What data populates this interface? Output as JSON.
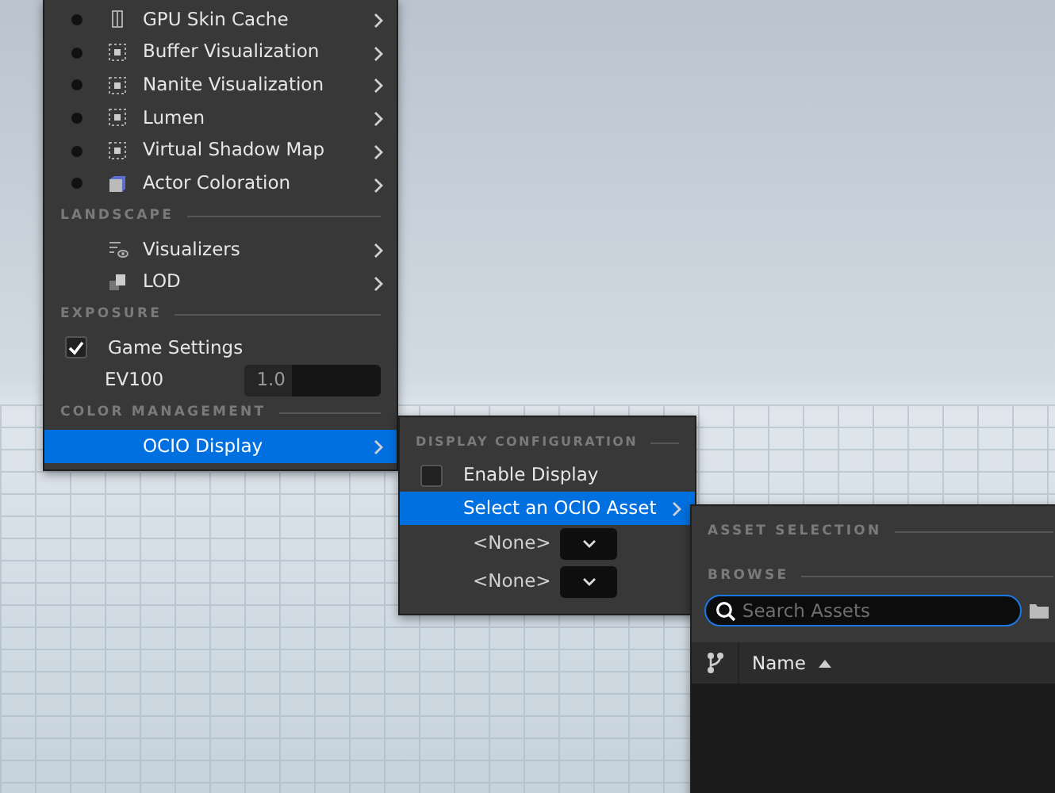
{
  "main_menu": {
    "items": [
      {
        "kind": "skin",
        "label": "GPU Skin Cache",
        "selected": false,
        "submenu": true
      },
      {
        "kind": "grid",
        "label": "Buffer Visualization",
        "selected": false,
        "submenu": true
      },
      {
        "kind": "grid",
        "label": "Nanite Visualization",
        "selected": false,
        "submenu": true
      },
      {
        "kind": "grid",
        "label": "Lumen",
        "selected": false,
        "submenu": true
      },
      {
        "kind": "grid",
        "label": "Virtual Shadow Map",
        "selected": false,
        "submenu": true
      },
      {
        "kind": "cube",
        "label": "Actor Coloration",
        "selected": false,
        "submenu": true
      },
      {
        "kind": "header",
        "label": "LANDSCAPE"
      },
      {
        "kind": "visualizers",
        "label": "Visualizers",
        "submenu": true
      },
      {
        "kind": "lod",
        "label": "LOD",
        "submenu": true
      },
      {
        "kind": "header",
        "label": "EXPOSURE"
      },
      {
        "kind": "checkbox",
        "label": "Game Settings",
        "checked": true
      },
      {
        "kind": "number",
        "label": "EV100",
        "value": "1.0"
      },
      {
        "kind": "header",
        "label": "COLOR MANAGEMENT"
      },
      {
        "kind": "plain",
        "label": "OCIO Display",
        "submenu": true,
        "highlighted": true
      }
    ]
  },
  "display_menu": {
    "items": [
      {
        "kind": "header",
        "label": "DISPLAY CONFIGURATION"
      },
      {
        "kind": "checkbox",
        "label": "Enable Display",
        "checked": false
      },
      {
        "kind": "plain",
        "label": "Select an OCIO Asset",
        "submenu": true,
        "highlighted": true
      },
      {
        "kind": "combo",
        "label": "<None>"
      },
      {
        "kind": "combo",
        "label": "<None>"
      }
    ]
  },
  "asset_picker": {
    "section": "ASSET SELECTION",
    "browse": "BROWSE",
    "search": {
      "placeholder": "Search Assets"
    },
    "columns": [
      {
        "label": "Name",
        "sorted": true
      }
    ]
  }
}
